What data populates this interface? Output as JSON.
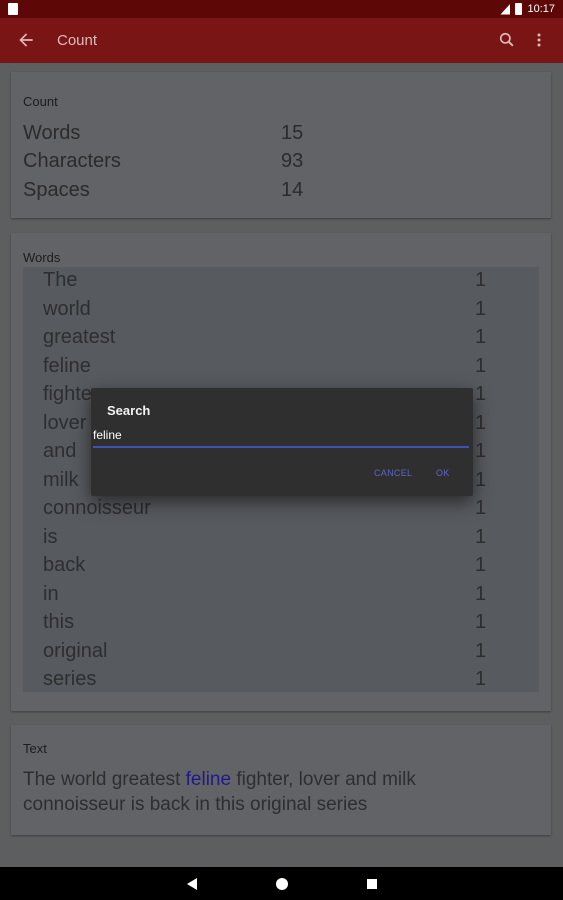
{
  "status_bar": {
    "time": "10:17"
  },
  "app_bar": {
    "title": "Count"
  },
  "count_card": {
    "heading": "Count",
    "rows": [
      {
        "label": "Words",
        "value": "15"
      },
      {
        "label": "Characters",
        "value": "93"
      },
      {
        "label": "Spaces",
        "value": "14"
      }
    ]
  },
  "words_card": {
    "heading": "Words",
    "rows": [
      {
        "word": "The",
        "count": "1"
      },
      {
        "word": "world",
        "count": "1"
      },
      {
        "word": "greatest",
        "count": "1"
      },
      {
        "word": "feline",
        "count": "1"
      },
      {
        "word": "fighter",
        "count": "1"
      },
      {
        "word": "lover",
        "count": "1"
      },
      {
        "word": "and",
        "count": "1"
      },
      {
        "word": "milk",
        "count": "1"
      },
      {
        "word": "connoisseur",
        "count": "1"
      },
      {
        "word": "is",
        "count": "1"
      },
      {
        "word": "back",
        "count": "1"
      },
      {
        "word": "in",
        "count": "1"
      },
      {
        "word": "this",
        "count": "1"
      },
      {
        "word": "original",
        "count": "1"
      },
      {
        "word": "series",
        "count": "1"
      }
    ]
  },
  "text_card": {
    "heading": "Text",
    "before": "The world greatest ",
    "highlight": "feline",
    "after": " fighter, lover and milk connoisseur is back in this original series"
  },
  "dialog": {
    "title": "Search",
    "input_value": "feline",
    "cancel_label": "CANCEL",
    "ok_label": "OK"
  },
  "icons": {
    "back": "arrow-back-icon",
    "search": "search-icon",
    "more": "more-vert-icon"
  },
  "colors": {
    "status_bar": "#5d0707",
    "app_bar": "#7a1515",
    "accent": "#3f51b5",
    "highlight_text": "#1f1b86"
  }
}
